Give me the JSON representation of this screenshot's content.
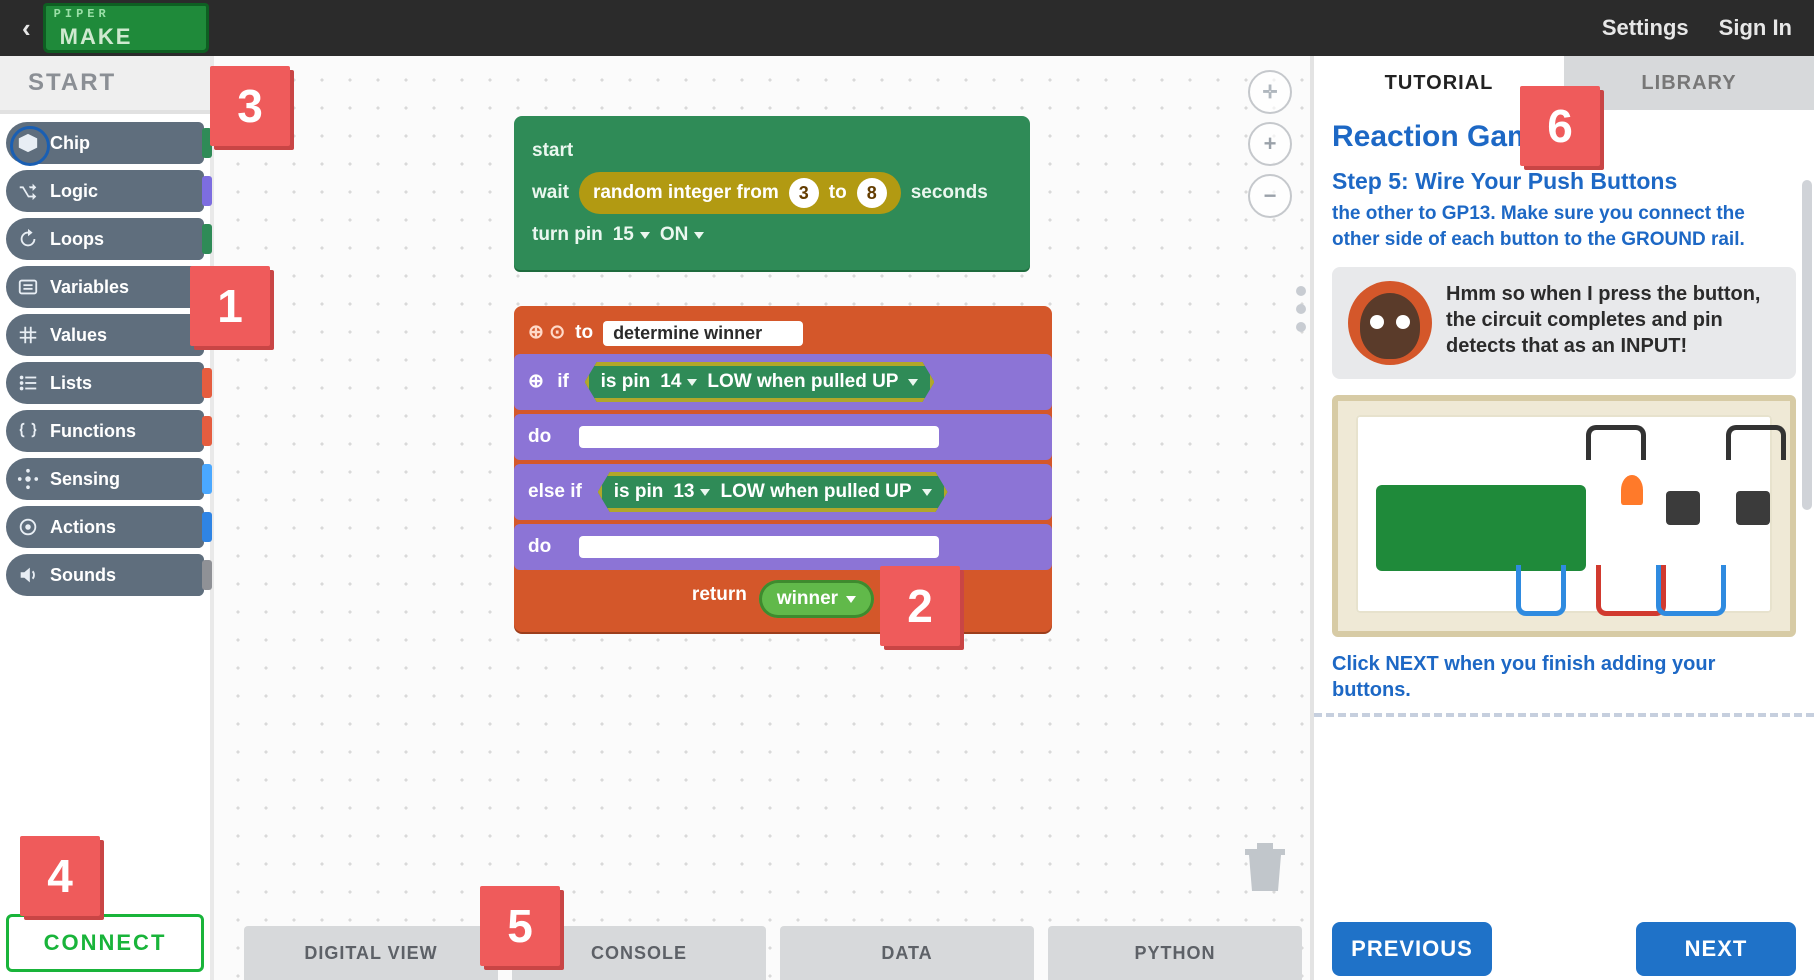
{
  "header": {
    "logo_top": "PIPER",
    "logo_bottom": "MAKE",
    "settings": "Settings",
    "signin": "Sign In"
  },
  "sidebar": {
    "start_label": "START",
    "items": [
      {
        "label": "Chip",
        "swatch": "green",
        "active": true
      },
      {
        "label": "Logic",
        "swatch": "purple"
      },
      {
        "label": "Loops",
        "swatch": "green"
      },
      {
        "label": "Variables",
        "swatch": "olive"
      },
      {
        "label": "Values",
        "swatch": "olive"
      },
      {
        "label": "Lists",
        "swatch": "red"
      },
      {
        "label": "Functions",
        "swatch": "red"
      },
      {
        "label": "Sensing",
        "swatch": "cyan"
      },
      {
        "label": "Actions",
        "swatch": "blue"
      },
      {
        "label": "Sounds",
        "swatch": "gray"
      }
    ],
    "connect_label": "CONNECT"
  },
  "workspace": {
    "stack1": {
      "l1": "start",
      "l2_left": "wait",
      "l2_chip_a": "random integer from",
      "l2_n1": "3",
      "l2_mid": "to",
      "l2_n2": "8",
      "l2_right": "seconds",
      "l3_a": "turn pin",
      "l3_pin": "15",
      "l3_on": "ON"
    },
    "func": {
      "to": "to",
      "name": "determine winner",
      "if": "if",
      "cond1_a": "is pin",
      "cond1_pin": "14",
      "cond1_b": "LOW when pulled UP",
      "do": "do",
      "elseif": "else if",
      "cond2_a": "is pin",
      "cond2_pin": "13",
      "cond2_b": "LOW when pulled UP",
      "return": "return",
      "retvar": "winner"
    },
    "tabs": [
      {
        "label": "DIGITAL VIEW"
      },
      {
        "label": "CONSOLE"
      },
      {
        "label": "DATA"
      },
      {
        "label": "PYTHON"
      }
    ]
  },
  "right": {
    "tab_tutorial": "TUTORIAL",
    "tab_library": "LIBRARY",
    "title": "Reaction Game",
    "step": "Step 5: Wire Your Push Buttons",
    "para_part1": "the other to ",
    "para_gp": "GP13",
    "para_part2": ". Make sure you connect the other side of each button to the ",
    "para_ground": "GROUND",
    "para_part3": " rail.",
    "speech": "Hmm so when I press the button, the circuit completes and pin detects that as an INPUT!",
    "instr_a": "Click ",
    "instr_b": "NEXT",
    "instr_c": " when you finish adding your buttons.",
    "prev": "PREVIOUS",
    "next": "NEXT"
  },
  "badges": {
    "b1": "1",
    "b2": "2",
    "b3": "3",
    "b4": "4",
    "b5": "5",
    "b6": "6"
  }
}
